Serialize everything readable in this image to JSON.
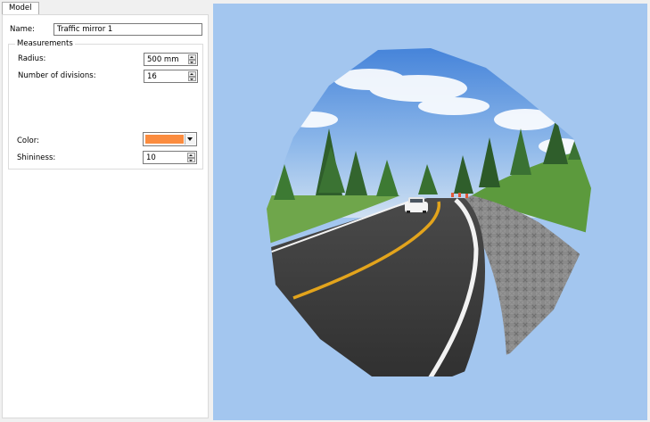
{
  "tabs": {
    "model": "Model"
  },
  "properties": {
    "name_label": "Name:",
    "name_value": "Traffic mirror 1",
    "measurements_title": "Measurements",
    "radius_label": "Radius:",
    "radius_value": "500 mm",
    "divisions_label": "Number of divisions:",
    "divisions_value": "16",
    "color_label": "Color:",
    "color_value": "#fb8c3f",
    "shininess_label": "Shininess:",
    "shininess_value": "10"
  },
  "colors": {
    "viewport_background": "#a3c6ef",
    "road_center_line": "#e3a41c",
    "road_edge_line": "#f2f2f2"
  },
  "icons": {
    "spin_up": "triangle-up",
    "spin_down": "triangle-down",
    "dropdown": "triangle-down"
  }
}
